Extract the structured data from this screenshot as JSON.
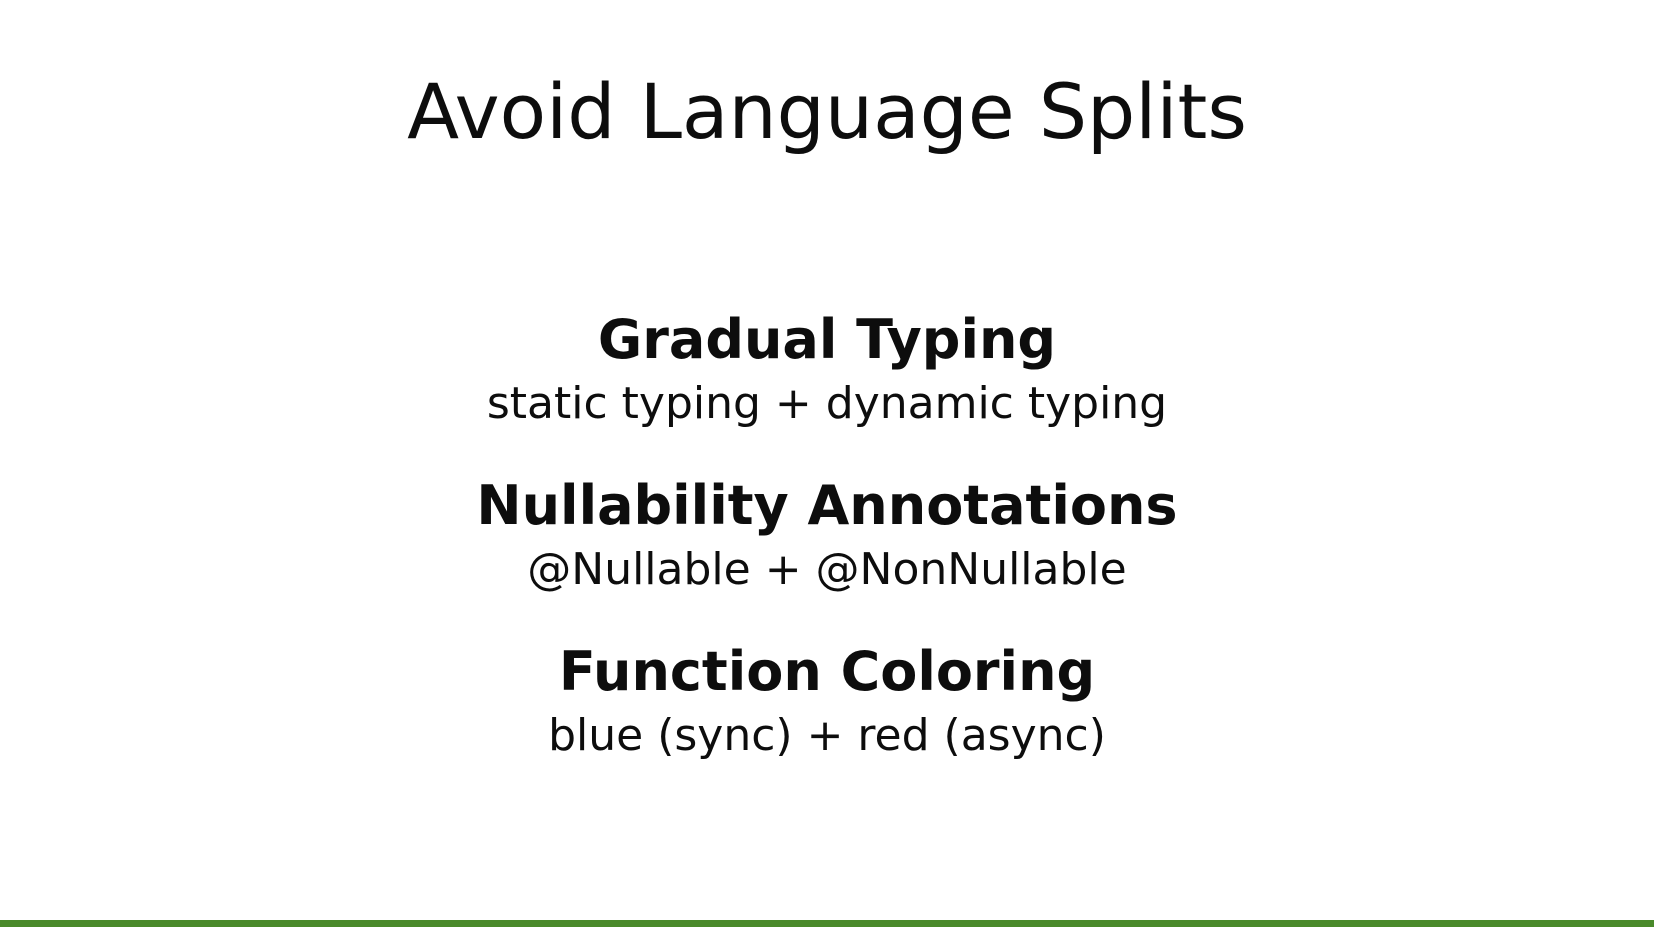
{
  "slide": {
    "title": "Avoid Language Splits",
    "items": [
      {
        "heading": "Gradual Typing",
        "subtitle": "static typing + dynamic typing"
      },
      {
        "heading": "Nullability Annotations",
        "subtitle": "@Nullable + @NonNullable"
      },
      {
        "heading": "Function Coloring",
        "subtitle": "blue (sync) + red (async)"
      }
    ]
  },
  "colors": {
    "background": "#ffffff",
    "text": "#0d0d0d",
    "accent_bar": "#4a8a2a"
  }
}
